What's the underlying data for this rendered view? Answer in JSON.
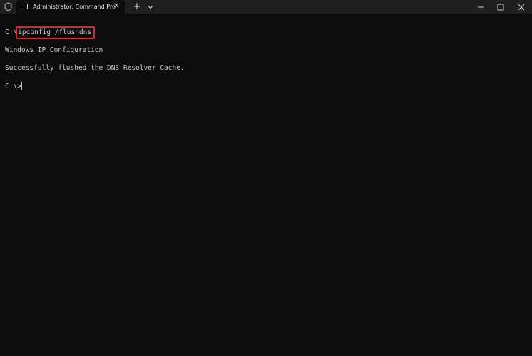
{
  "titlebar": {
    "tab_title": "Administrator: Command Pro",
    "tab_close_icon": "close-icon",
    "new_tab_label": "+",
    "dropdown_icon": "chevron-down-icon",
    "window_controls": [
      "minimize-icon",
      "maximize-icon",
      "close-icon"
    ]
  },
  "terminal": {
    "prompt1": "C:\\",
    "command": "ipconfig /flushdns",
    "output_line1": "Windows IP Configuration",
    "output_line2": "Successfully flushed the DNS Resolver Cache.",
    "prompt2": "C:\\>"
  },
  "colors": {
    "background": "#0c0c0c",
    "titlebar": "#1f1f1f",
    "text": "#cccccc",
    "highlight_border": "#e0262e"
  }
}
